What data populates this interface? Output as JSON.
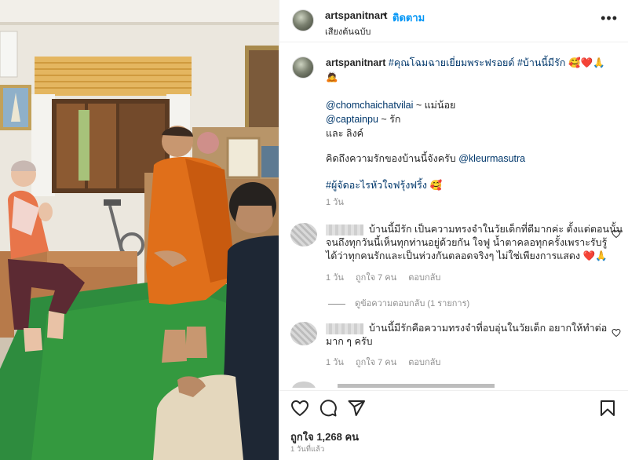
{
  "header": {
    "username": "artspanitnart",
    "separator": "•",
    "follow_label": "ติดตาม",
    "audio_label": "เสียงต้นฉบับ",
    "more_label": "•••"
  },
  "caption": {
    "username": "artspanitnart",
    "hashtags_line": "#คุณโฉมฉายเยี่ยมพระฟรอยด์ #บ้านนี้มีรัก",
    "line1_emoji": "🥰❤️🙏",
    "line2_emoji": "🙇",
    "mention1": "@chomchaichatvilai",
    "mention1_suffix": " ~ แม่น้อย",
    "mention2": "@captainpu",
    "mention2_suffix": " ~ รัก",
    "line_and": "และ ลิงค์",
    "miss_text": "คิดถึงความรักของบ้านนี้จังครับ ",
    "mention3": "@kleurmasutra",
    "hashtag2": "#ผู้จัดอะไรหัวใจฟรุ้งฟริ้ง",
    "hashtag2_emoji": " 🥰",
    "time": "1 วัน"
  },
  "comments": [
    {
      "text_line1": "บ้านนี้มีรัก เป็นความทรงจำในวัยเด็กที่ดีมากค่ะ ตั้งแต่ตอนนั้น",
      "text_line2": "จนถึงทุกวันนี้เห็นทุกท่านอยู่ด้วยกัน ใจฟู น้ำตาคลอทุกครั้งเพราะรับรู้",
      "text_line3": "ได้ว่าทุกคนรักและเป็นห่วงกันตลอดจริงๆ ไม่ใช่เพียงการแสดง ❤️🙏",
      "time": "1 วัน",
      "likes": "ถูกใจ 7 คน",
      "reply": "ตอบกลับ"
    },
    {
      "text_line1": "บ้านนี้มีรักคือความทรงจำที่อบอุ่นในวัยเด็ก อยากให้ทำต่อ",
      "text_line2": "มาก ๆ ครับ",
      "time": "1 วัน",
      "likes": "ถูกใจ 7 คน",
      "reply": "ตอบกลับ"
    }
  ],
  "view_replies_label": "ดูข้อความตอบกลับ (1 รายการ)",
  "actions": {
    "like_icon": "heart-outline-icon",
    "comment_icon": "comment-bubble-icon",
    "share_icon": "paper-plane-icon",
    "save_icon": "bookmark-icon"
  },
  "likes_label": "ถูกใจ 1,268 คน",
  "post_time": "1 วันที่แล้ว",
  "colors": {
    "link_blue": "#0095f6",
    "tag_blue": "#00376b",
    "muted_gray": "#8e8e8e",
    "text": "#262626"
  }
}
